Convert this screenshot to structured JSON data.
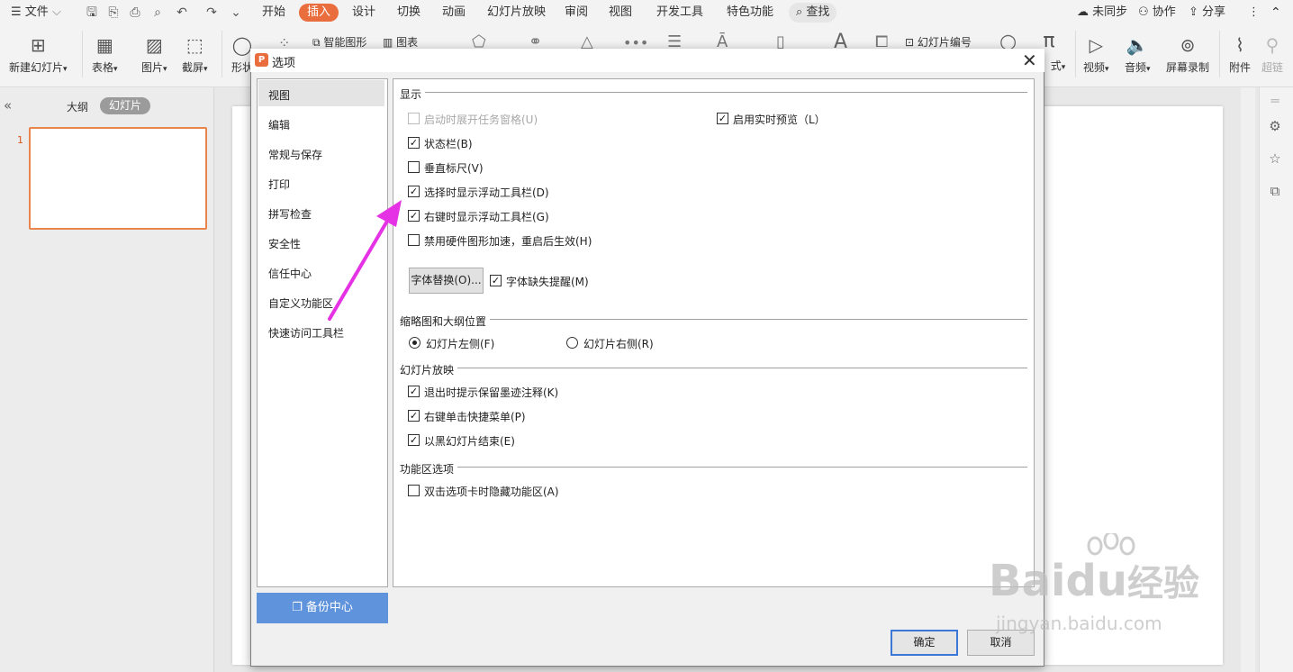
{
  "menubar": {
    "file": "文件",
    "tabs": [
      "开始",
      "插入",
      "设计",
      "切换",
      "动画",
      "幻灯片放映",
      "审阅",
      "视图",
      "开发工具",
      "特色功能"
    ],
    "active_tab": "插入",
    "search": "查找",
    "right": [
      "未同步",
      "协作",
      "分享"
    ]
  },
  "ribbon": {
    "new_slide": "新建幻灯片",
    "table": "表格",
    "picture": "图片",
    "screenshot": "截屏",
    "shape": "形状",
    "smart_art": "智能图形",
    "chart": "图表",
    "slide_number": "幻灯片编号",
    "formula_suffix": "式",
    "video": "视频",
    "audio": "音频",
    "screen_record": "屏幕录制",
    "attachment": "附件",
    "hyperlink": "超链"
  },
  "leftpanel": {
    "outline": "大纲",
    "slides": "幻灯片",
    "slide_number": "1"
  },
  "dialog": {
    "title": "选项",
    "nav": [
      "视图",
      "编辑",
      "常规与保存",
      "打印",
      "拼写检查",
      "安全性",
      "信任中心",
      "自定义功能区",
      "快速访问工具栏"
    ],
    "backup": "备份中心",
    "ok": "确定",
    "cancel": "取消",
    "sections": {
      "display": "显示",
      "thumb_pos": "缩略图和大纲位置",
      "slideshow": "幻灯片放映",
      "ribbon_opts": "功能区选项"
    },
    "display": {
      "startup_taskpane": "启动时展开任务窗格(U)",
      "live_preview": "启用实时预览（L）",
      "status_bar": "状态栏(B)",
      "vertical_ruler": "垂直标尺(V)",
      "float_select": "选择时显示浮动工具栏(D)",
      "float_right": "右键时显示浮动工具栏(G)",
      "disable_hw": "禁用硬件图形加速，重启后生效(H)",
      "font_sub": "字体替换(O)...",
      "font_missing": "字体缺失提醒(M)"
    },
    "thumb_pos": {
      "left": "幻灯片左侧(F)",
      "right": "幻灯片右侧(R)"
    },
    "slideshow": {
      "ink_prompt": "退出时提示保留墨迹注释(K)",
      "right_menu": "右键单击快捷菜单(P)",
      "end_black": "以黑幻灯片结束(E)"
    },
    "ribbon_opts": {
      "dblclick_hide": "双击选项卡时隐藏功能区(A)"
    }
  },
  "watermark": {
    "brand": "Bai",
    "brand2": "du",
    "cn": "经验",
    "url": "jingyan.baidu.com"
  }
}
